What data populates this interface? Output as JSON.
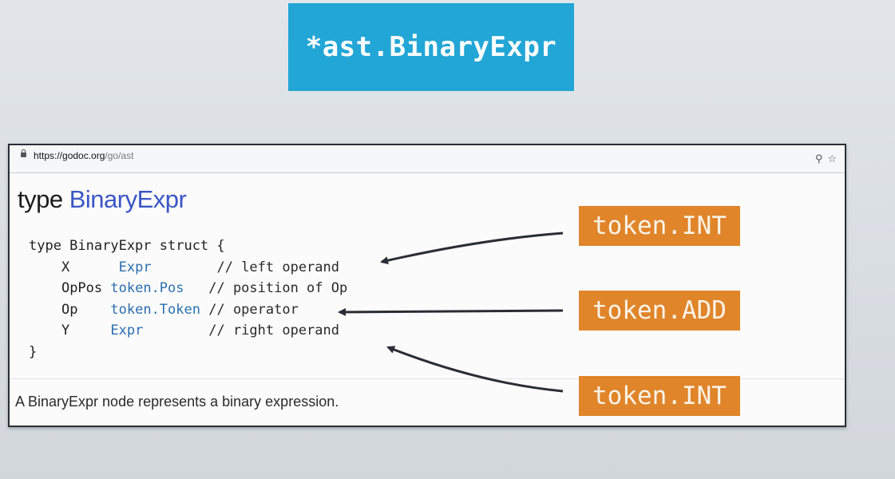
{
  "slide": {
    "title": "*ast.BinaryExpr"
  },
  "browser": {
    "url_scheme_host": "https://godoc.org",
    "url_path": "/go/ast",
    "zoom_icon": "⚲",
    "bookmark_icon": "☆"
  },
  "doc": {
    "heading_prefix": "type",
    "heading_name": "BinaryExpr",
    "code": {
      "line1": "type BinaryExpr struct {",
      "fields": [
        {
          "name": "X",
          "type": "Expr",
          "comment": "// left operand"
        },
        {
          "name": "OpPos",
          "type": "token.Pos",
          "comment": "// position of Op"
        },
        {
          "name": "Op",
          "type": "token.Token",
          "comment": "// operator"
        },
        {
          "name": "Y",
          "type": "Expr",
          "comment": "// right operand"
        }
      ],
      "close": "}"
    },
    "description": "A BinaryExpr node represents a binary expression."
  },
  "annotations": [
    {
      "label": "token.INT",
      "color": "#e0852a"
    },
    {
      "label": "token.ADD",
      "color": "#e0852a"
    },
    {
      "label": "token.INT",
      "color": "#e0852a"
    }
  ]
}
